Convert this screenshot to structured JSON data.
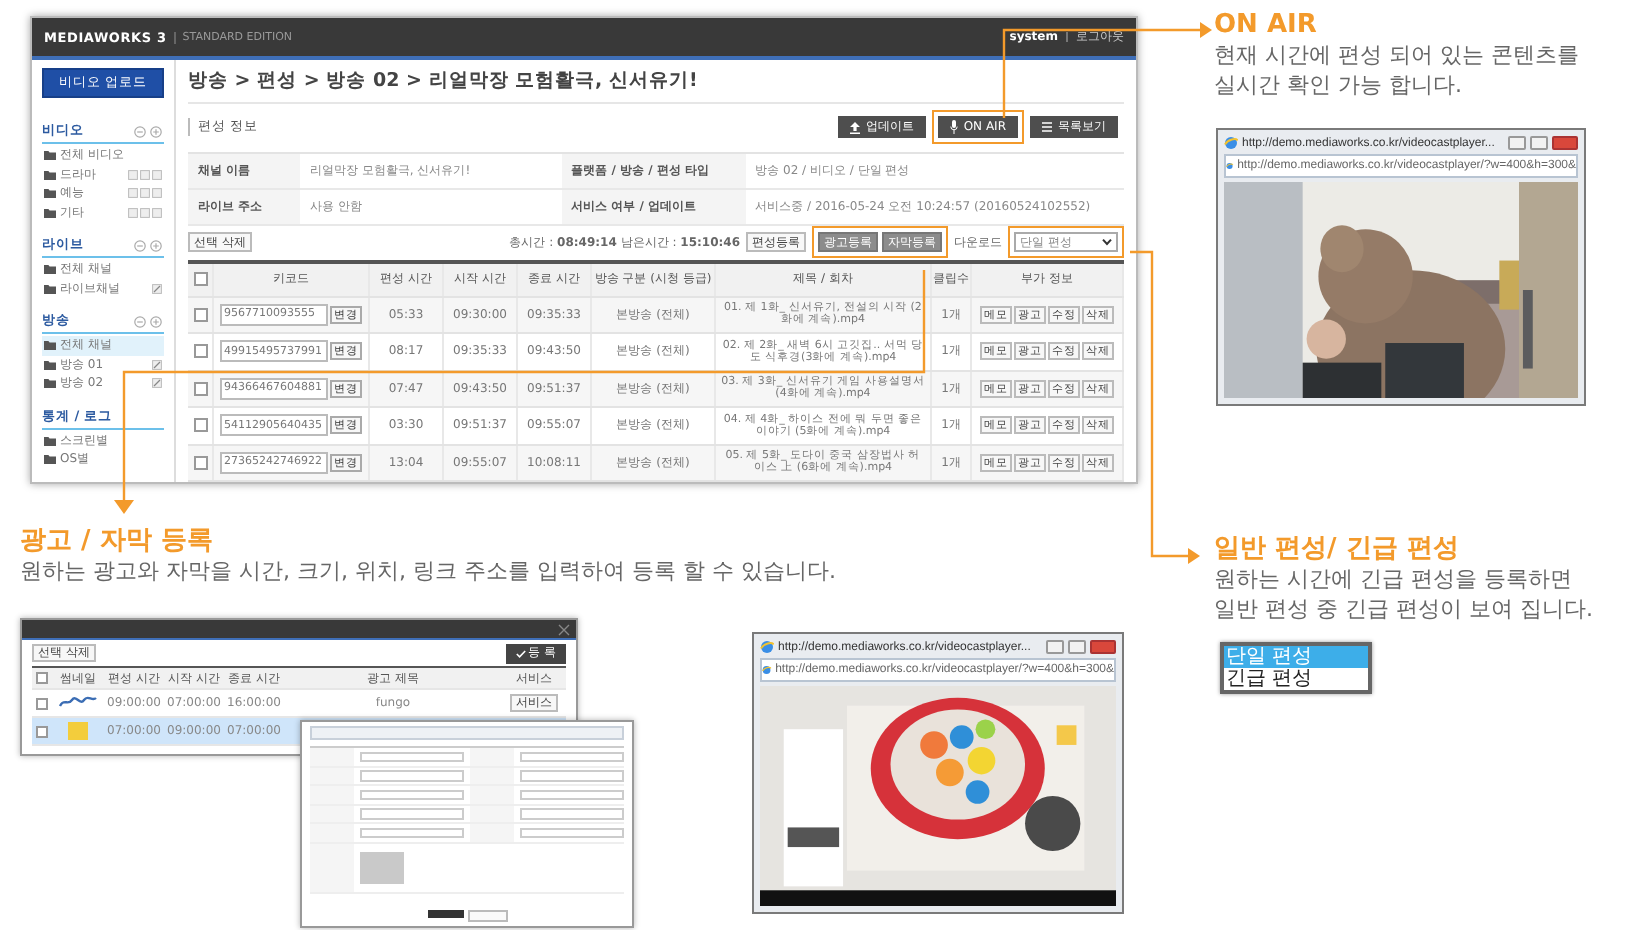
{
  "app_window": {
    "logo": "MEDIAWORKS 3",
    "edition": "STANDARD EDITION",
    "user": "system",
    "logout": "로그아웃",
    "sidebar": {
      "upload_button": "비디오 업로드",
      "sections": [
        {
          "title": "비디오",
          "items": [
            {
              "label": "전체 비디오",
              "kind": "plain",
              "selected": false
            },
            {
              "label": "드라마",
              "kind": "tools",
              "selected": false
            },
            {
              "label": "예능",
              "kind": "tools",
              "selected": false
            },
            {
              "label": "기타",
              "kind": "tools",
              "selected": false
            }
          ]
        },
        {
          "title": "라이브",
          "items": [
            {
              "label": "전체 채널",
              "kind": "plain",
              "selected": false
            },
            {
              "label": "라이브채널",
              "kind": "edit",
              "selected": false
            }
          ]
        },
        {
          "title": "방송",
          "items": [
            {
              "label": "전체 채널",
              "kind": "plain",
              "selected": true
            },
            {
              "label": "방송 01",
              "kind": "edit",
              "selected": false
            },
            {
              "label": "방송 02",
              "kind": "edit",
              "selected": false
            }
          ]
        },
        {
          "title": "통계 / 로그",
          "items": [
            {
              "label": "스크린별",
              "kind": "plain",
              "selected": false
            },
            {
              "label": "OS별",
              "kind": "plain",
              "selected": false
            }
          ]
        }
      ]
    },
    "breadcrumb": "방송 > 편성 > 방송 02 > 리얼막장 모험활극, 신서유기!",
    "section_label": "편성 정보",
    "toolbar": [
      {
        "label": "업데이트",
        "kind": "upload",
        "highlighted": false
      },
      {
        "label": "ON AIR",
        "kind": "mic",
        "highlighted": true
      },
      {
        "label": "목록보기",
        "kind": "list",
        "highlighted": false
      }
    ],
    "info": [
      [
        {
          "label": "채널 이름",
          "value": "리얼막장 모험활극, 신서유기!"
        },
        {
          "label": "플랫폼 / 방송 / 편성 타입",
          "value": "방송 02 / 비디오 / 단일 편성"
        }
      ],
      [
        {
          "label": "라이브 주소",
          "value": "사용 안함"
        },
        {
          "label": "서비스 여부 / 업데이트",
          "value": "서비스중 / 2016-05-24 오전 10:24:57 (20160524102552)"
        }
      ]
    ],
    "delete_button": "선택 삭제",
    "summary": "총시간 : **08:49:14**  남은시간 : **15:10:46**",
    "schedule_button": "편성등록",
    "ad_buttons": {
      "highlighted": true,
      "labels": [
        "광고등록",
        "자막등록"
      ]
    },
    "download_label": "다운로드",
    "schedule_select": {
      "value": "단일 편성",
      "highlighted": true
    },
    "table": {
      "select_all_checked": false,
      "columns": [
        "키코드",
        "편성 시간",
        "시작 시간",
        "종료 시간",
        "방송 구분 (시청 등급)",
        "제목 / 회차",
        "클립수",
        "부가 정보"
      ],
      "rows": [
        {
          "checked": false,
          "code": "9567710093555",
          "change_button": "변경",
          "duration": "05:33",
          "start": "09:30:00",
          "end": "09:35:33",
          "type": "본방송 (전체)",
          "title": "01. 제 1화_ 신서유기, 전설의 시작 (2화에 계속).mp4",
          "clips": "1개",
          "buttons": [
            "메모",
            "광고",
            "수정",
            "삭제"
          ]
        },
        {
          "checked": false,
          "code": "49915495737991",
          "change_button": "변경",
          "duration": "08:17",
          "start": "09:35:33",
          "end": "09:43:50",
          "type": "본방송 (전체)",
          "title": "02. 제 2화_ 새벽 6시 고깃집.. 서먹 당도 식후경(3화에 계속).mp4",
          "clips": "1개",
          "buttons": [
            "메모",
            "광고",
            "수정",
            "삭제"
          ]
        },
        {
          "checked": false,
          "code": "94366467604881",
          "change_button": "변경",
          "duration": "07:47",
          "start": "09:43:50",
          "end": "09:51:37",
          "type": "본방송 (전체)",
          "title": "03. 제 3화_ 신서유기 게임 사용설명서 (4화에 계속).mp4",
          "clips": "1개",
          "buttons": [
            "메모",
            "광고",
            "수정",
            "삭제"
          ]
        },
        {
          "checked": false,
          "code": "54112905640435",
          "change_button": "변경",
          "duration": "03:30",
          "start": "09:51:37",
          "end": "09:55:07",
          "type": "본방송 (전체)",
          "title": "04. 제 4화_ 하이스 전에 뭐 두면 좋은 이야기 (5화에 계속).mp4",
          "clips": "1개",
          "buttons": [
            "메모",
            "광고",
            "수정",
            "삭제"
          ]
        },
        {
          "checked": false,
          "code": "27365242746922",
          "change_button": "변경",
          "duration": "13:04",
          "start": "09:55:07",
          "end": "10:08:11",
          "type": "본방송 (전체)",
          "title": "05. 제 5화_ 도다이 중국 삼장법사 허이스 上 (6화에 계속).mp4",
          "clips": "1개",
          "buttons": [
            "메모",
            "광고",
            "수정",
            "삭제"
          ]
        }
      ]
    }
  },
  "callouts": [
    {
      "title": "ON AIR",
      "lines": [
        "현재 시간에 편성 되어 있는 콘텐츠를",
        "실시간 확인 가능 합니다."
      ]
    },
    {
      "title": "광고 / 자막 등록",
      "lines": [
        "원하는 광고와 자막을 시간, 크기, 위치, 링크 주소를 입력하여 등록 할 수 있습니다."
      ]
    },
    {
      "title": "일반 편성/ 긴급 편성",
      "lines": [
        "원하는 시간에 긴급 편성을 등록하면",
        "일반 편성 중 긴급 편성이 보여 집니다."
      ]
    }
  ],
  "schedule_listbox": [
    {
      "label": "단일 편성",
      "selected": true
    },
    {
      "label": "긴급 편성",
      "selected": false
    }
  ],
  "players": [
    {
      "title": "http://demo.mediaworks.co.kr/videocastplayer...",
      "address": "http://demo.mediaworks.co.kr/videocastplayer/?w=400&h=300&",
      "kind": "picture"
    },
    {
      "title": "http://demo.mediaworks.co.kr/videocastplayer...",
      "address": "http://demo.mediaworks.co.kr/videocastplayer/?w=400&h=300&",
      "kind": "picture"
    }
  ],
  "ad_dialog": {
    "delete_button": "선택 삭제",
    "register_button": "등 록",
    "select_all_checked": false,
    "columns": [
      "썸네일",
      "편성 시간",
      "시작 시간",
      "종료 시간",
      "광고 제목",
      "서비스"
    ],
    "rows": [
      {
        "selected": false,
        "checked": false,
        "start": "09:00:00",
        "end": "07:00:00",
        "close": "16:00:00",
        "title": "fungo",
        "service": "서비스"
      },
      {
        "selected": true,
        "checked": false,
        "start": "07:00:00",
        "end": "09:00:00",
        "close": "07:00:00",
        "title": "",
        "service": ""
      }
    ]
  }
}
